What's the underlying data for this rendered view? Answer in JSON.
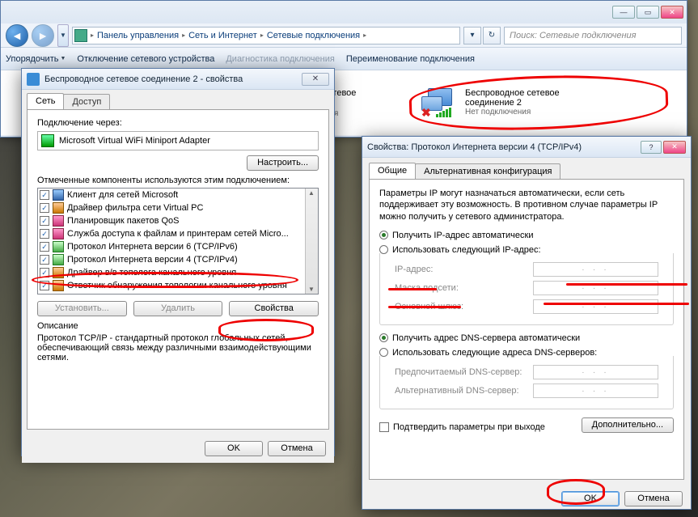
{
  "explorer": {
    "breadcrumb": [
      "Панель управления",
      "Сеть и Интернет",
      "Сетевые подключения"
    ],
    "search_placeholder": "Поиск: Сетевые подключения",
    "toolbar": {
      "organize": "Упорядочить",
      "disable": "Отключение сетевого устройства",
      "diagnose": "Диагностика подключения",
      "rename": "Переименование подключения"
    },
    "item_left": {
      "line1": "Беспроводное сетевое",
      "line2_and_3": "соединение\nНет подключения"
    },
    "item_right": {
      "line1": "Беспроводное сетевое",
      "line2": "соединение 2",
      "line3": "Нет подключения"
    }
  },
  "props": {
    "title": "Беспроводное сетевое соединение 2 - свойства",
    "tab_net": "Сеть",
    "tab_access": "Доступ",
    "conn_via": "Подключение через:",
    "adapter": "Microsoft Virtual WiFi Miniport Adapter",
    "configure": "Настроить...",
    "components_label": "Отмеченные компоненты используются этим подключением:",
    "components": [
      "Клиент для сетей Microsoft",
      "Драйвер фильтра сети Virtual PC",
      "Планировщик пакетов QoS",
      "Служба доступа к файлам и принтерам сетей Micro...",
      "Протокол Интернета версии 6 (TCP/IPv6)",
      "Протокол Интернета версии 4 (TCP/IPv4)",
      "Драйвер в/в тополога канального уровня",
      "Ответчик обнаружения топологии канального уровня"
    ],
    "install": "Установить...",
    "remove": "Удалить",
    "properties": "Свойства",
    "desc_label": "Описание",
    "desc_text": "Протокол TCP/IP - стандартный протокол глобальных сетей, обеспечивающий связь между различными взаимодействующими сетями.",
    "ok": "OK",
    "cancel": "Отмена"
  },
  "ipv4": {
    "title": "Свойства: Протокол Интернета версии 4 (TCP/IPv4)",
    "tab_general": "Общие",
    "tab_alt": "Альтернативная конфигурация",
    "info": "Параметры IP могут назначаться автоматически, если сеть поддерживает эту возможность. В противном случае параметры IP можно получить у сетевого администратора.",
    "r_auto_ip": "Получить IP-адрес автоматически",
    "r_manual_ip": "Использовать следующий IP-адрес:",
    "ip_addr": "IP-адрес:",
    "mask": "Маска подсети:",
    "gateway": "Основной шлюз:",
    "r_auto_dns": "Получить адрес DNS-сервера автоматически",
    "r_manual_dns": "Использовать следующие адреса DNS-серверов:",
    "dns1": "Предпочитаемый DNS-сервер:",
    "dns2": "Альтернативный DNS-сервер:",
    "confirm_exit": "Подтвердить параметры при выходе",
    "advanced": "Дополнительно...",
    "ok": "OK",
    "cancel": "Отмена",
    "ip_placeholder": ".   .   ."
  }
}
